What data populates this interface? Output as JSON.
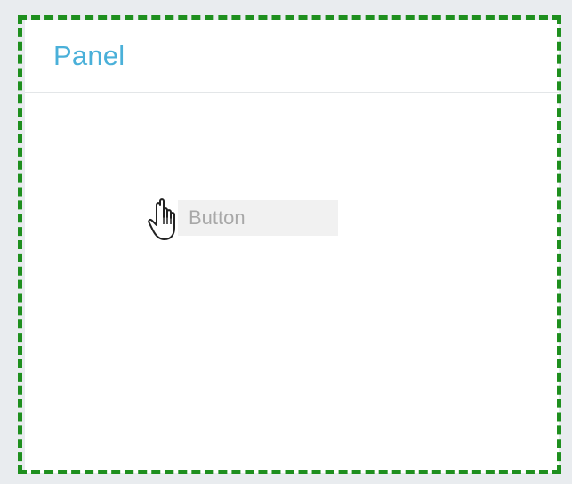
{
  "panel": {
    "title": "Panel"
  },
  "button": {
    "label": "Button"
  },
  "cursor": {
    "icon": "hand-pointer-icon"
  },
  "colors": {
    "title": "#4ab0d9",
    "drop_outline": "#1e8f1e",
    "button_bg": "#efefef",
    "button_text": "#9a9a9a",
    "background": "#e9ecef"
  }
}
